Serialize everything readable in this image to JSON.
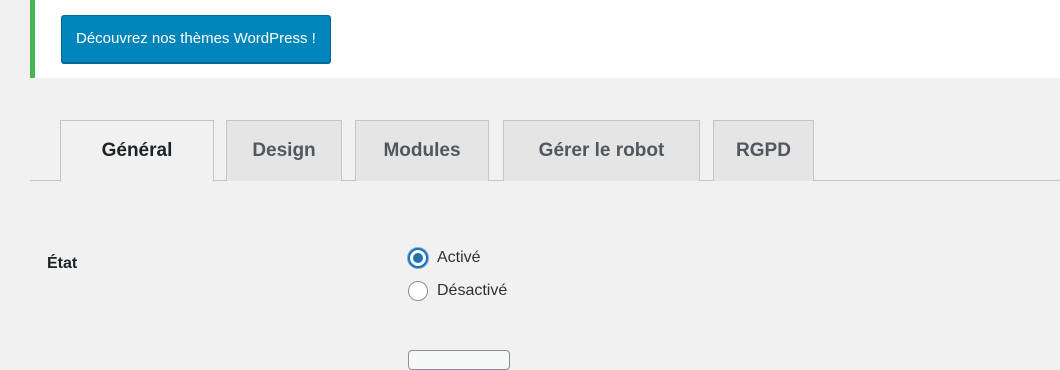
{
  "notice": {
    "button_label": "Découvrez nos thèmes WordPress !",
    "accent_color": "#46b450",
    "button_color": "#0085ba"
  },
  "tabs": [
    {
      "label": "Général",
      "active": true
    },
    {
      "label": "Design",
      "active": false
    },
    {
      "label": "Modules",
      "active": false
    },
    {
      "label": "Gérer le robot",
      "active": false
    },
    {
      "label": "RGPD",
      "active": false
    }
  ],
  "settings": {
    "state_label": "État",
    "options": [
      {
        "label": "Activé",
        "checked": true
      },
      {
        "label": "Désactivé",
        "checked": false
      }
    ]
  }
}
